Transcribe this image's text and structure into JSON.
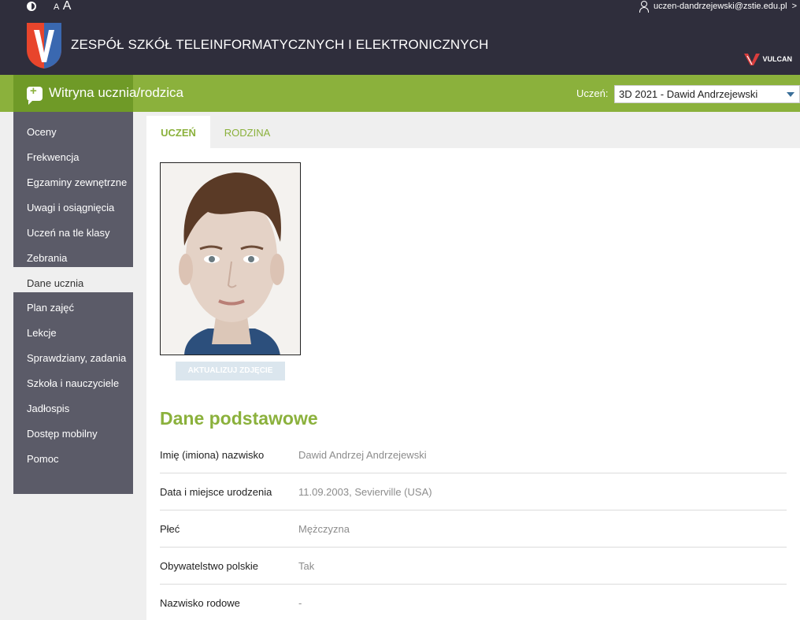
{
  "header": {
    "font_size_small": "A",
    "font_size_big": "A",
    "user_email": "uczen-dandrzejewski@zstie.edu.pl",
    "user_caret": ">",
    "school_name": "ZESPÓŁ SZKÓŁ TELEINFORMATYCZNYCH I ELEKTRONICZNYCH",
    "vendor": "VULCAN"
  },
  "toolbar": {
    "app_title": "Witryna ucznia/rodzica",
    "student_label": "Uczeń:",
    "student_selected": "3D 2021 - Dawid Andrzejewski"
  },
  "sidebar": {
    "items": [
      {
        "label": "Oceny"
      },
      {
        "label": "Frekwencja"
      },
      {
        "label": "Egzaminy zewnętrzne"
      },
      {
        "label": "Uwagi i osiągnięcia"
      },
      {
        "label": "Uczeń na tle klasy"
      },
      {
        "label": "Zebrania"
      },
      {
        "label": "Dane ucznia"
      },
      {
        "label": "Plan zajęć"
      },
      {
        "label": "Lekcje"
      },
      {
        "label": "Sprawdziany, zadania"
      },
      {
        "label": "Szkoła i nauczyciele"
      },
      {
        "label": "Jadłospis"
      },
      {
        "label": "Dostęp mobilny"
      },
      {
        "label": "Pomoc"
      }
    ],
    "active_index": 6
  },
  "tabs": [
    {
      "label": "UCZEŃ"
    },
    {
      "label": "RODZINA"
    }
  ],
  "photo": {
    "update_button": "AKTUALIZUJ ZDJĘCIE"
  },
  "section": {
    "title": "Dane podstawowe",
    "rows": [
      {
        "label": "Imię (imiona) nazwisko",
        "value": "Dawid Andrzej Andrzejewski"
      },
      {
        "label": "Data i miejsce urodzenia",
        "value": "11.09.2003, Sevierville (USA)"
      },
      {
        "label": "Płeć",
        "value": "Mężczyzna"
      },
      {
        "label": "Obywatelstwo polskie",
        "value": "Tak"
      },
      {
        "label": "Nazwisko rodowe",
        "value": "-"
      }
    ]
  },
  "colors": {
    "accent": "#8bb13c",
    "header_bg": "#2f2e3c",
    "sidebar_bg": "#5b5b68"
  }
}
